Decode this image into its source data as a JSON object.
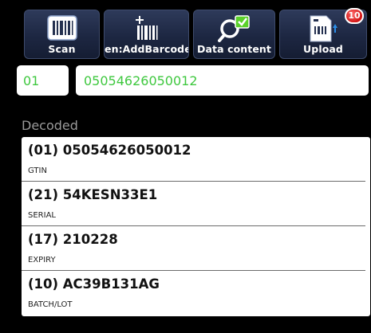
{
  "toolbar": {
    "buttons": [
      {
        "label": "Scan"
      },
      {
        "label": "en:AddBarcode"
      },
      {
        "label": "Data content"
      },
      {
        "label": "Upload",
        "badge": "10"
      }
    ],
    "icons": [
      "barcode-icon",
      "add-barcode-icon",
      "data-content-icon",
      "upload-icon"
    ]
  },
  "input": {
    "ai_value": "01",
    "value": "05054626050012",
    "text_color": "#3fc83f"
  },
  "decoded": {
    "label": "Decoded",
    "items": [
      {
        "value": "(01) 05054626050012",
        "name": "GTIN"
      },
      {
        "value": "(21) 54KESN33E1",
        "name": "SERIAL"
      },
      {
        "value": "(17) 210228",
        "name": "EXPIRY"
      },
      {
        "value": "(10) AC39B131AG",
        "name": "BATCH/LOT"
      }
    ]
  },
  "colors": {
    "toolbar_button": "#1d2742",
    "badge": "#d11414",
    "check": "#5bd12b"
  }
}
